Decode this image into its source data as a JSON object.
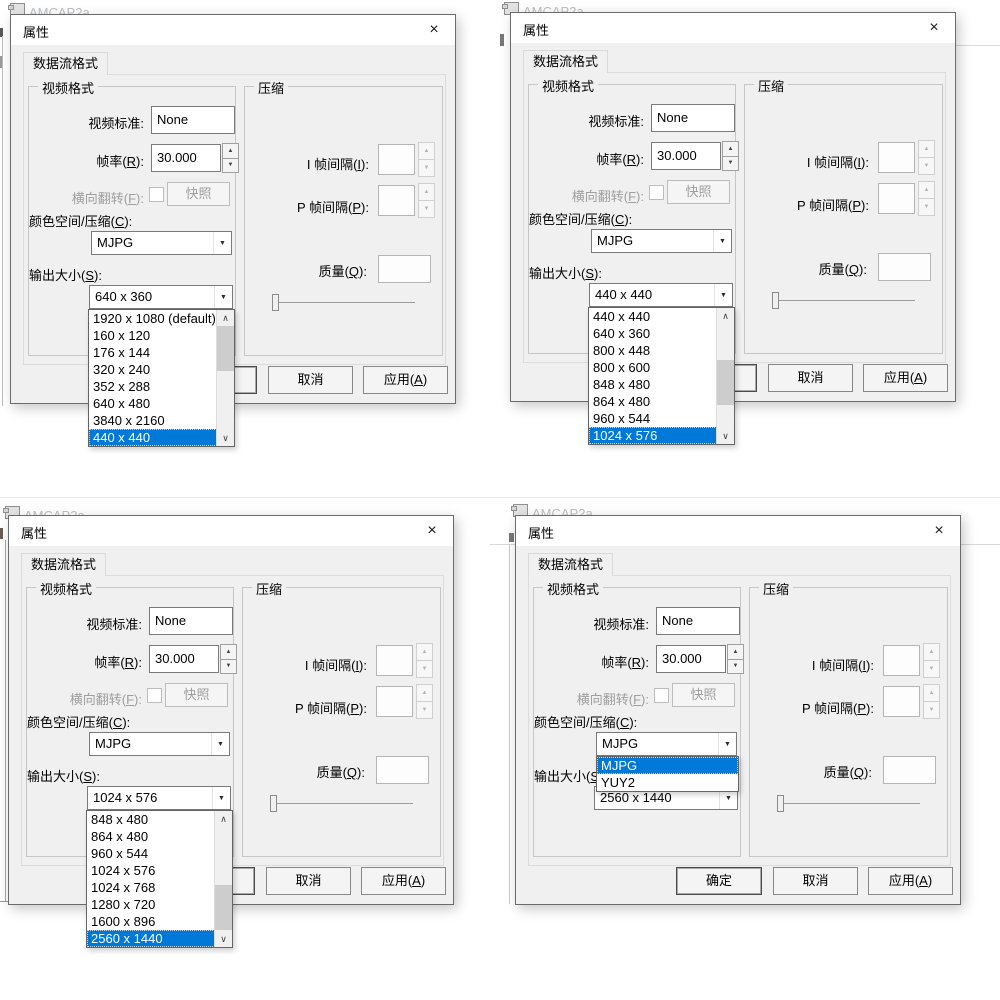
{
  "background": {
    "window_title": "AMCAP2a"
  },
  "dialog": {
    "title": "属性",
    "close_glyph": "×",
    "tab": "数据流格式",
    "groups": {
      "video": "视频格式",
      "compression": "压缩"
    },
    "fields": {
      "video_standard_label": "视频标准:",
      "video_standard_value": "None",
      "frame_rate_label": "帧率(R):",
      "frame_rate_value": "30.000",
      "flip_label": "横向翻转(F):",
      "snapshot_label": "快照",
      "colorspace_label": "颜色空间/压缩(C):",
      "output_size_label": "输出大小(S):",
      "i_interval_label": "I 帧间隔(I):",
      "p_interval_label": "P 帧间隔(P):",
      "quality_label": "质量(Q):"
    },
    "buttons": {
      "ok": "确定",
      "cancel": "取消",
      "apply": "应用(A)"
    },
    "accent_color": "#0078d7"
  },
  "panels": [
    {
      "position": "top-left",
      "colorspace": "MJPG",
      "output_size": "640 x 360",
      "dropdown": {
        "kind": "output-size",
        "items": [
          "1920 x 1080  (default)",
          "160 x 120",
          "176 x 144",
          "320 x 240",
          "352 x 288",
          "640 x 480",
          "3840 x 2160",
          "440 x 440"
        ],
        "selected_index": 7,
        "thumb": "top"
      }
    },
    {
      "position": "top-right",
      "colorspace": "MJPG",
      "output_size": "440 x 440",
      "dropdown": {
        "kind": "output-size",
        "items": [
          "440 x 440",
          "640 x 360",
          "800 x 448",
          "800 x 600",
          "848 x 480",
          "864 x 480",
          "960 x 544",
          "1024 x 576"
        ],
        "selected_index": 7,
        "thumb": "middle"
      }
    },
    {
      "position": "bottom-left",
      "colorspace": "MJPG",
      "output_size": "1024 x 576",
      "dropdown": {
        "kind": "output-size",
        "items": [
          "848 x 480",
          "864 x 480",
          "960 x 544",
          "1024 x 576",
          "1024 x 768",
          "1280 x 720",
          "1600 x 896",
          "2560 x 1440"
        ],
        "selected_index": 7,
        "thumb": "bottom"
      }
    },
    {
      "position": "bottom-right",
      "colorspace": "MJPG",
      "output_size": "2560 x 1440",
      "dropdown": {
        "kind": "colorspace",
        "items": [
          "MJPG",
          "YUY2"
        ],
        "selected_index": 0
      }
    }
  ]
}
